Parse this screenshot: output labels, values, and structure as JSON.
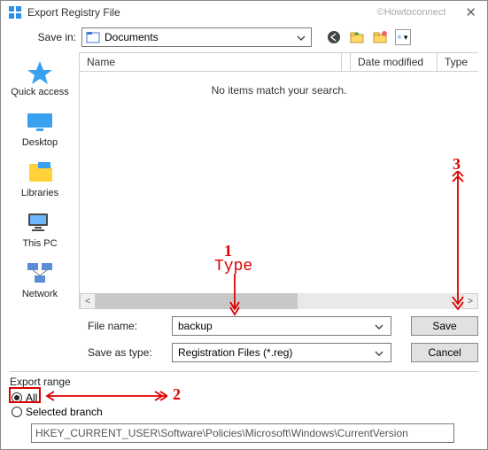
{
  "title": "Export Registry File",
  "watermark": "©Howtoconnect",
  "savein": {
    "label": "Save in:",
    "value": "Documents"
  },
  "columns": {
    "name": "Name",
    "date": "Date modified",
    "type": "Type"
  },
  "empty_message": "No items match your search.",
  "places": {
    "quick_access": "Quick access",
    "desktop": "Desktop",
    "libraries": "Libraries",
    "this_pc": "This PC",
    "network": "Network"
  },
  "fields": {
    "filename_label": "File name:",
    "filename_value": "backup",
    "saveas_label": "Save as type:",
    "saveas_value": "Registration Files (*.reg)"
  },
  "buttons": {
    "save": "Save",
    "cancel": "Cancel"
  },
  "export_range": {
    "label": "Export range",
    "all": "All",
    "selected": "Selected branch",
    "branch_value": "HKEY_CURRENT_USER\\Software\\Policies\\Microsoft\\Windows\\CurrentVersion"
  },
  "annotations": {
    "n1": "1",
    "n2": "2",
    "n3": "3",
    "type_label": "Type"
  }
}
